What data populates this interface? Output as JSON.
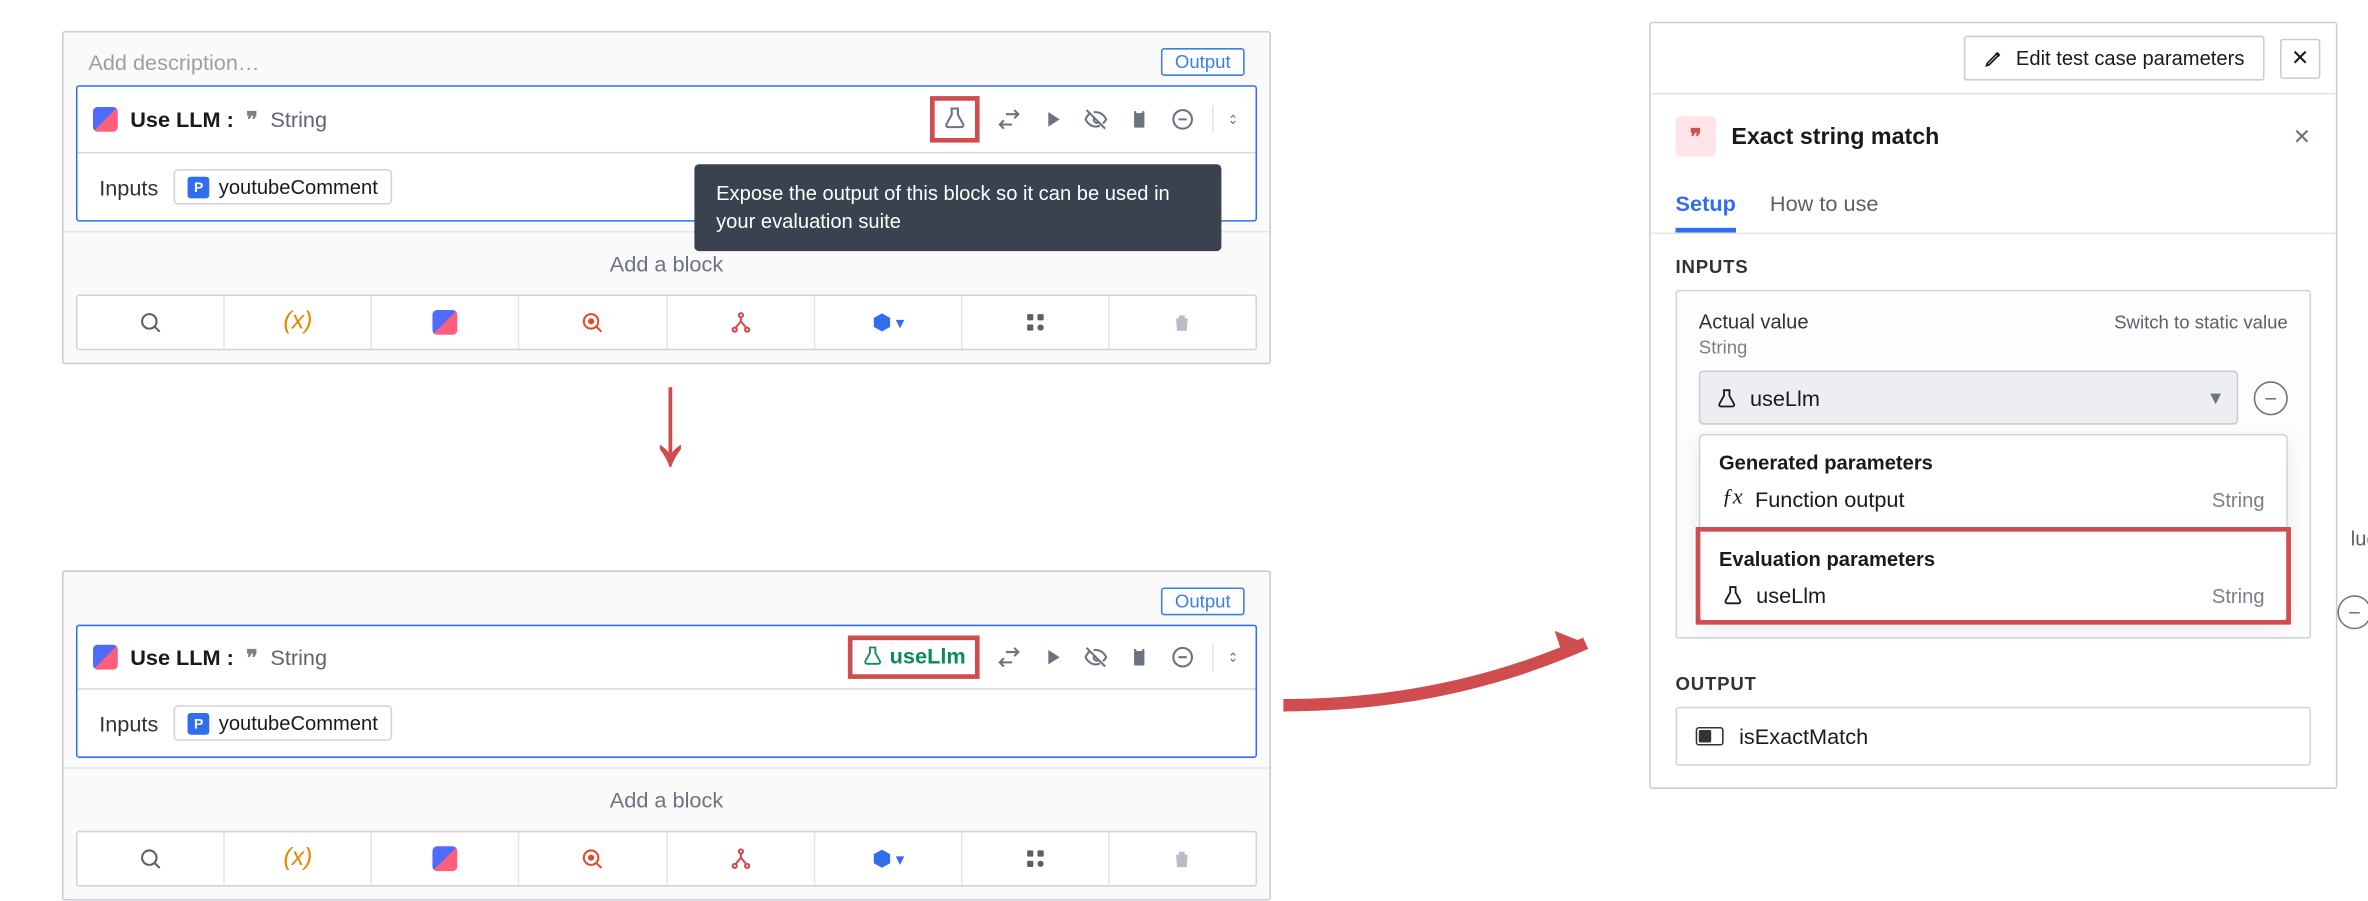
{
  "colors": {
    "accent": "#2f6fed",
    "danger": "#cf4c4f",
    "green": "#0b8a5a"
  },
  "panel": {
    "add_description": "Add description…",
    "output_chip": "Output",
    "block": {
      "title": "Use LLM :",
      "type": "String",
      "beaker_name": "useLlm"
    },
    "inputs_label": "Inputs",
    "input_chip": "youtubeComment",
    "add_block": "Add a block",
    "tooltip": "Expose the output of this block so it can be used in your evaluation suite"
  },
  "right": {
    "edit_btn": "Edit test case parameters",
    "title": "Exact string match",
    "tabs": {
      "setup": "Setup",
      "howto": "How to use"
    },
    "inputs_label": "INPUTS",
    "actual_value": "Actual value",
    "switch": "Switch to static value",
    "string": "String",
    "selected": "useLlm",
    "groups": {
      "generated": "Generated parameters",
      "generated_item": "Function output",
      "eval": "Evaluation parameters",
      "eval_item": "useLlm",
      "type": "String"
    },
    "hidden_text": "lue",
    "output_label": "OUTPUT",
    "output_value": "isExactMatch"
  }
}
